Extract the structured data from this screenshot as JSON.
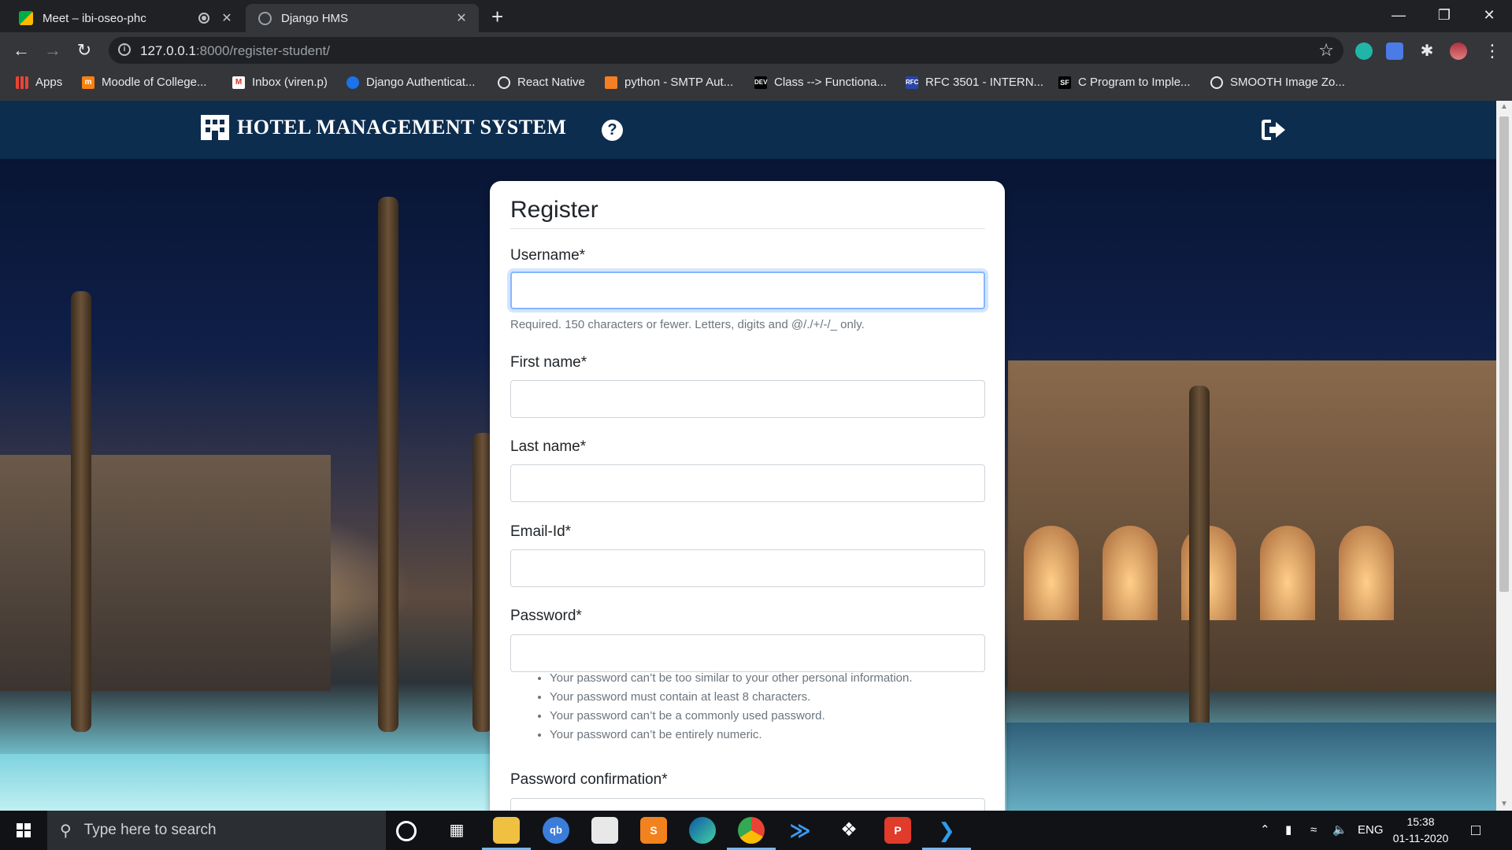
{
  "browser": {
    "tabs": [
      {
        "title": "Meet – ibi-oseo-phc",
        "active": false,
        "favicon": "google-meet-icon",
        "close": "✕"
      },
      {
        "title": "Django HMS",
        "active": true,
        "favicon": "globe-icon",
        "close": "✕"
      }
    ],
    "new_tab": "+",
    "window_controls": {
      "minimize": "—",
      "maximize": "❐",
      "close": "✕"
    },
    "url_host": "127.0.0.1",
    "url_path": ":8000/register-student/",
    "bookmarks": [
      {
        "label": "Apps",
        "icon": "apps-grid-icon"
      },
      {
        "label": "Moodle of College...",
        "icon": "moodle-icon"
      },
      {
        "label": "Inbox (viren.p)",
        "icon": "gmail-icon"
      },
      {
        "label": "Django Authenticat...",
        "icon": "django-auth-icon"
      },
      {
        "label": "React Native",
        "icon": "globe-icon"
      },
      {
        "label": "python - SMTP Aut...",
        "icon": "stackoverflow-icon"
      },
      {
        "label": "Class --> Functiona...",
        "icon": "dev-icon"
      },
      {
        "label": "RFC 3501 - INTERN...",
        "icon": "rfc-icon"
      },
      {
        "label": "C Program to Imple...",
        "icon": "sf-icon"
      },
      {
        "label": "SMOOTH Image Zo...",
        "icon": "globe-icon"
      }
    ]
  },
  "site": {
    "brand": "HOTEL MANAGEMENT SYSTEM",
    "help_glyph": "?"
  },
  "form": {
    "title": "Register",
    "username_label": "Username*",
    "username_value": "",
    "username_help": "Required. 150 characters or fewer. Letters, digits and @/./+/-/_ only.",
    "first_name_label": "First name*",
    "first_name_value": "",
    "last_name_label": "Last name*",
    "last_name_value": "",
    "email_label": "Email-Id*",
    "email_value": "",
    "password_label": "Password*",
    "password_value": "",
    "password_rules": [
      "Your password can’t be too similar to your other personal information.",
      "Your password must contain at least 8 characters.",
      "Your password can’t be a commonly used password.",
      "Your password can’t be entirely numeric."
    ],
    "password_confirm_label": "Password confirmation*"
  },
  "taskbar": {
    "search_placeholder": "Type here to search",
    "apps": [
      "cortana",
      "task-view",
      "file-explorer",
      "qbittorrent",
      "microsoft-store",
      "sublime-text",
      "edge",
      "chrome",
      "visual-studio",
      "dropbox",
      "postman",
      "vscode"
    ],
    "tray_lang": "ENG",
    "time": "15:38",
    "date": "01-11-2020"
  },
  "colors": {
    "navbar": "#0d2d4e",
    "focus_ring": "#86b7fe",
    "chrome_dark": "#202124",
    "chrome_toolbar": "#35363a"
  }
}
